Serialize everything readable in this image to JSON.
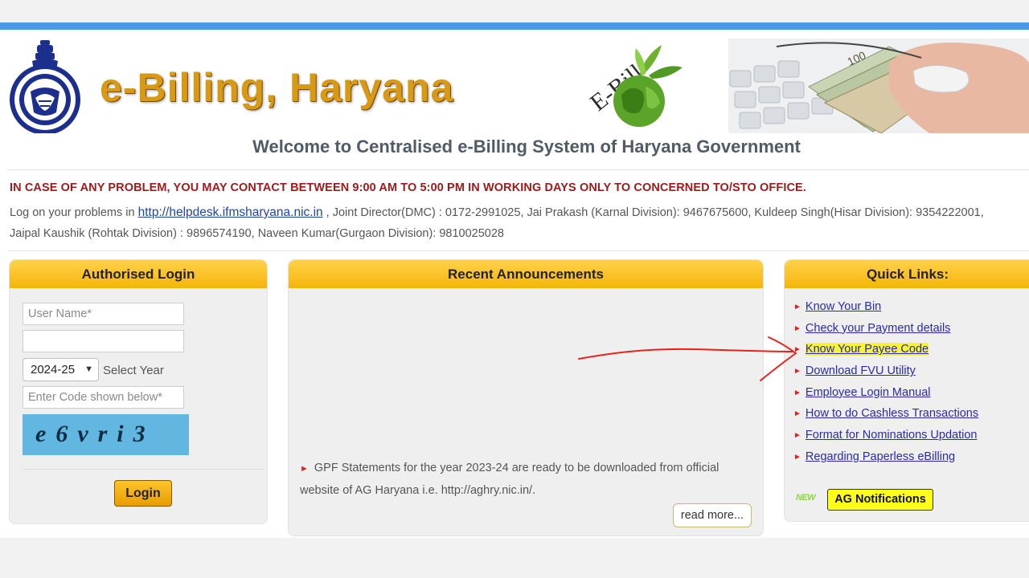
{
  "header": {
    "site_title": "e-Billing, Haryana",
    "logo_text": "E-Bill",
    "welcome": "Welcome to Centralised e-Billing System of Haryana Government"
  },
  "notice": {
    "warning": "IN CASE OF ANY PROBLEM, YOU MAY CONTACT BETWEEN 9:00 AM TO 5:00 PM IN WORKING DAYS ONLY TO CONCERNED TO/STO OFFICE.",
    "contact_prefix": "Log on your problems in ",
    "helpdesk_link": "http://helpdesk.ifmsharyana.nic.in",
    "contact_rest": " , Joint Director(DMC) : 0172-2991025, Jai Prakash (Karnal Division): 9467675600, Kuldeep Singh(Hisar Division): 9354222001, Jaipal Kaushik (Rohtak Division) : 9896574190, Naveen Kumar(Gurgaon Division): 9810025028"
  },
  "login": {
    "title": "Authorised Login",
    "username_placeholder": "User Name*",
    "password_value": "",
    "year_value": "2024-25",
    "year_label": "Select Year",
    "code_placeholder": "Enter Code shown below*",
    "captcha_text": "e6vri3",
    "login_button": "Login"
  },
  "announcements": {
    "title": "Recent Announcements",
    "items": [
      "GPF Statements for the year 2023-24 are ready to be downloaded from official website of AG Haryana i.e. http://aghry.nic.in/."
    ],
    "read_more": "read more..."
  },
  "quick_links": {
    "title": "Quick Links:",
    "items": [
      {
        "label": "Know Your Bin"
      },
      {
        "label": "Check your Payment details"
      },
      {
        "label": "Know Your Payee Code",
        "highlighted": true
      },
      {
        "label": "Download FVU Utility"
      },
      {
        "label": "Employee Login Manual"
      },
      {
        "label": "How to do Cashless Transactions"
      },
      {
        "label": "Format for Nominations Updation"
      },
      {
        "label": "Regarding Paperless eBilling"
      }
    ],
    "new_tag": "NEW",
    "ag_notifications": "AG Notifications"
  },
  "colors": {
    "panel_header": "#f6b40a",
    "title_gold": "#d89a14",
    "warning_red": "#9e1a1a",
    "link_blue": "#2a2ab0",
    "highlight": "#f7f23a",
    "annotation_red": "#e8221b"
  }
}
